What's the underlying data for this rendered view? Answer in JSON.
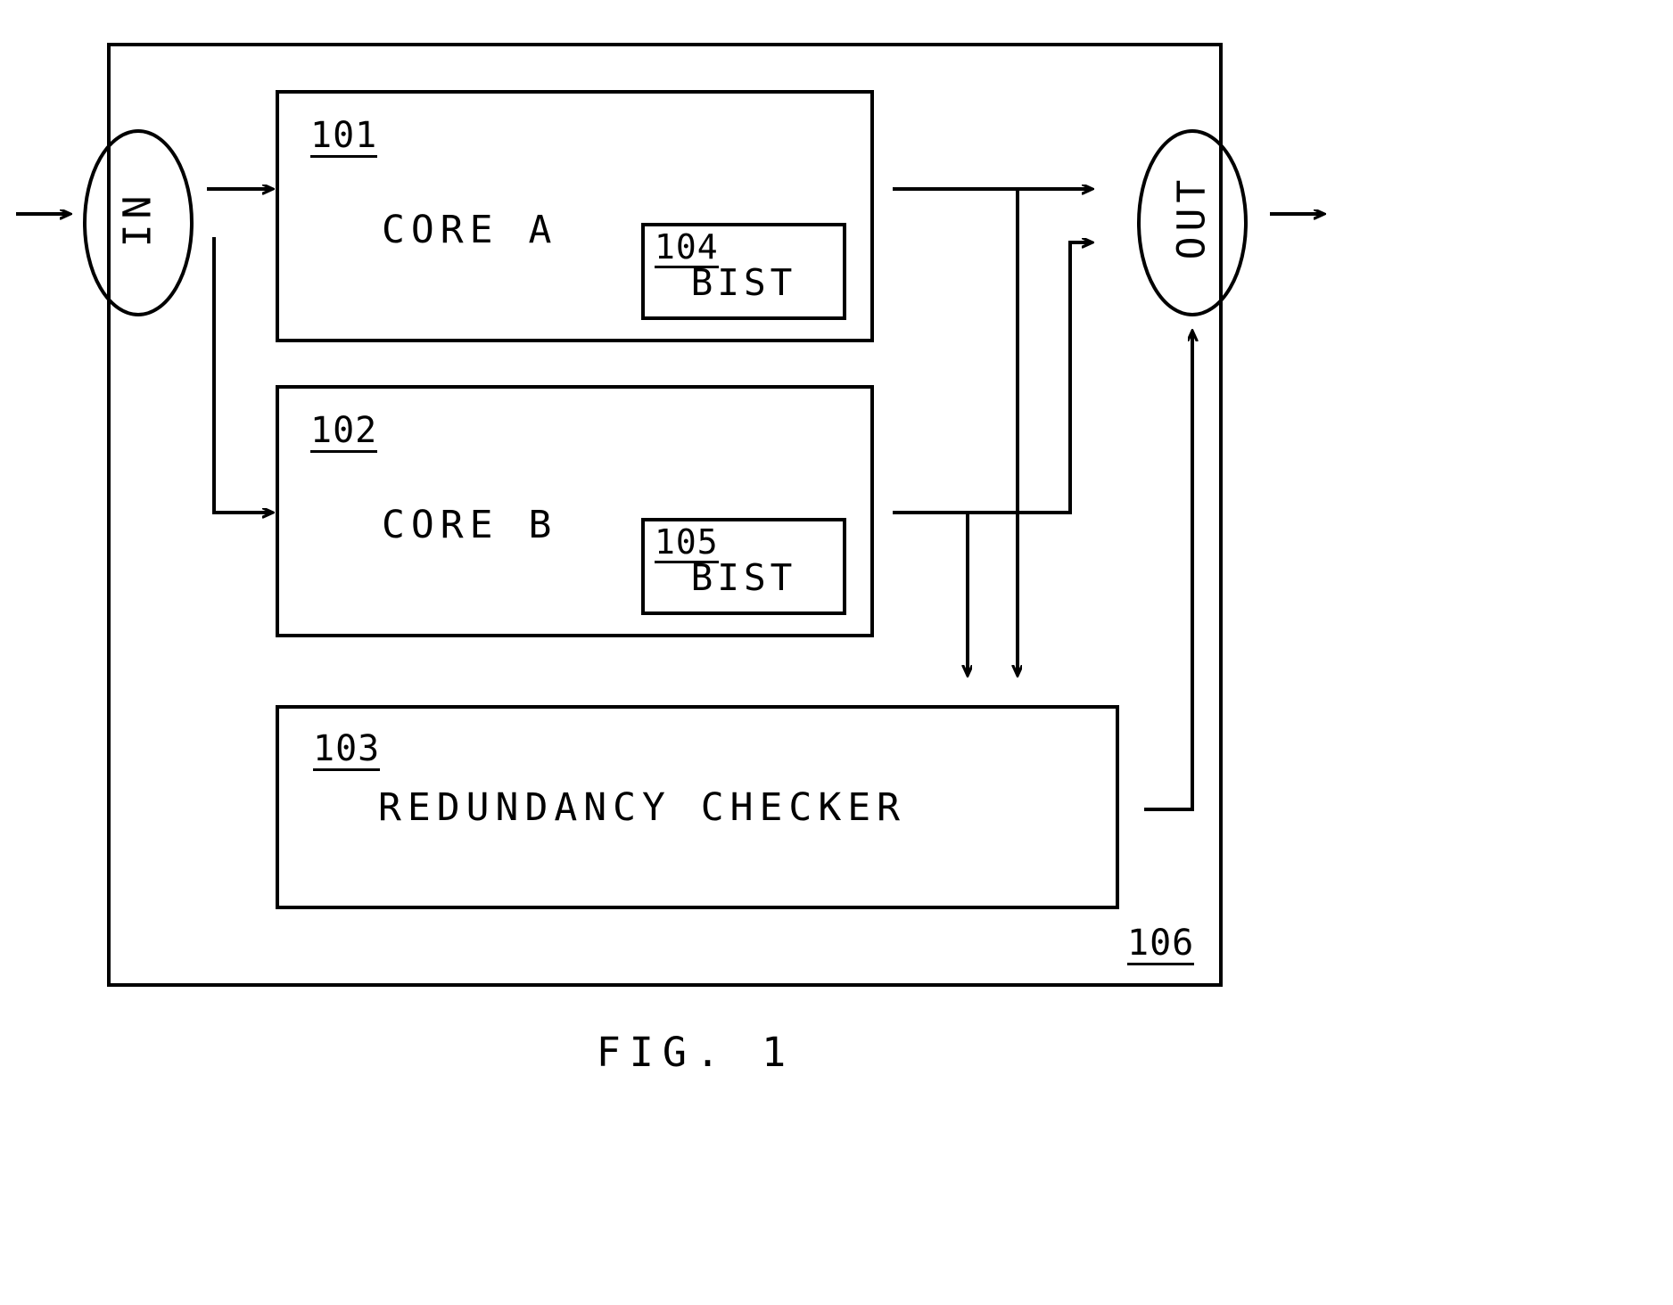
{
  "figure": {
    "caption": "FIG. 1",
    "system_ref": "106"
  },
  "terminals": [
    {
      "id": "in",
      "label": "IN",
      "name": "input-terminal"
    },
    {
      "id": "out",
      "label": "OUT",
      "name": "output-terminal"
    }
  ],
  "blocks": [
    {
      "ref": "101",
      "label": "CORE A",
      "name": "core-a-block"
    },
    {
      "ref": "102",
      "label": "CORE B",
      "name": "core-b-block"
    },
    {
      "ref": "103",
      "label": "REDUNDANCY CHECKER",
      "name": "redundancy-checker-block"
    }
  ],
  "subblocks": [
    {
      "ref": "104",
      "label": "BIST",
      "parent": "101",
      "name": "bist-a-block"
    },
    {
      "ref": "105",
      "label": "BIST",
      "parent": "102",
      "name": "bist-b-block"
    }
  ],
  "colors": {
    "line": "#000000",
    "background": "#ffffff"
  },
  "line_style": {
    "stroke_width": 4,
    "box_stroke_width": 4
  }
}
